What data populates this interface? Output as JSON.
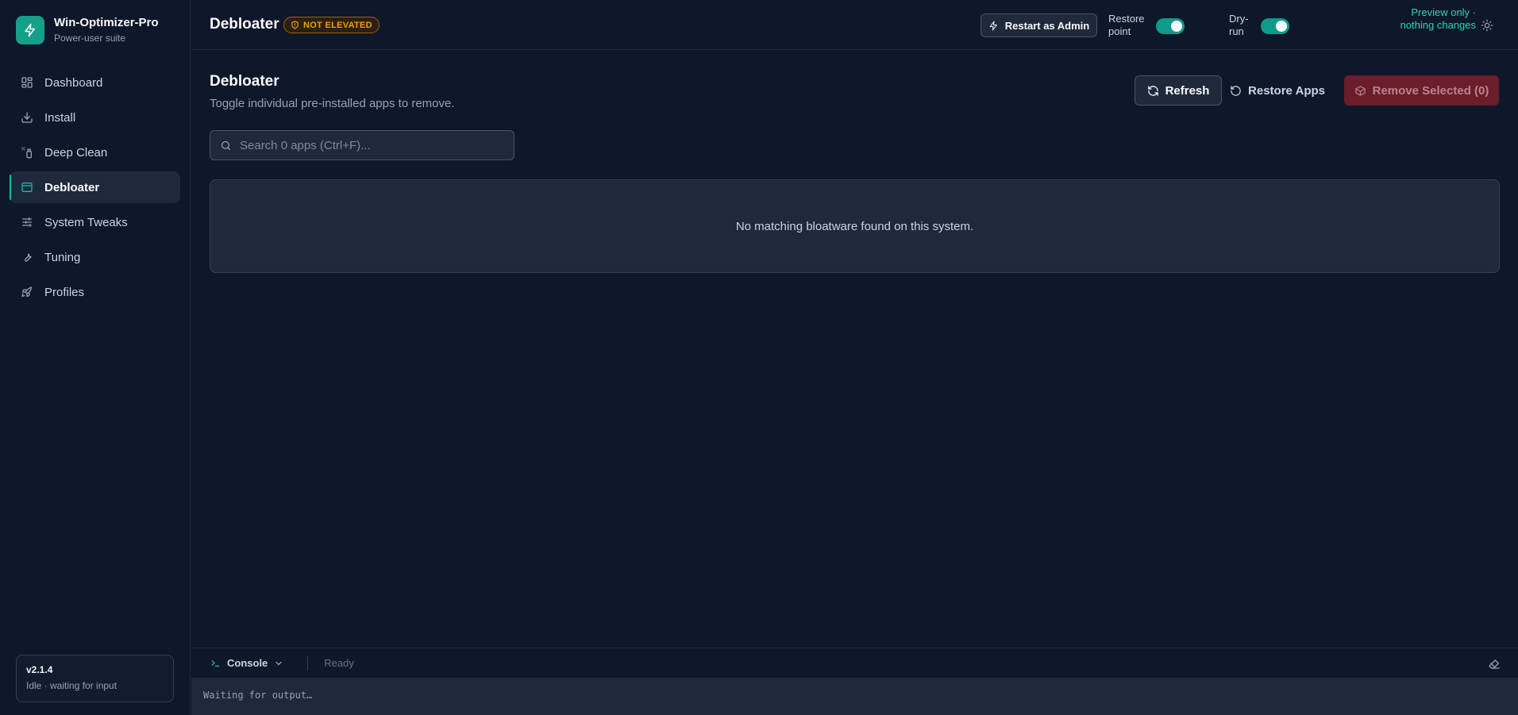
{
  "app": {
    "name": "Win-Optimizer-Pro",
    "subtitle": "Power-user suite",
    "logo_icon": "bolt-icon",
    "accent": "#14a08a"
  },
  "sidebar": {
    "items": [
      {
        "label": "Dashboard",
        "icon": "dashboard-icon",
        "active": false
      },
      {
        "label": "Install",
        "icon": "download-icon",
        "active": false
      },
      {
        "label": "Deep Clean",
        "icon": "spray-icon",
        "active": false
      },
      {
        "label": "Debloater",
        "icon": "window-icon",
        "active": true
      },
      {
        "label": "System Tweaks",
        "icon": "sliders-icon",
        "active": false
      },
      {
        "label": "Tuning",
        "icon": "wrench-icon",
        "active": false
      },
      {
        "label": "Profiles",
        "icon": "rocket-icon",
        "active": false
      }
    ],
    "version": "v2.1.4",
    "status": "Idle · waiting for input"
  },
  "header": {
    "title": "Debloater",
    "badge": "NOT ELEVATED",
    "badge_color": "#f59e0b",
    "restart_label": "Restart as Admin",
    "restore_point_label": "Restore point",
    "restore_point_on": true,
    "dry_run_label": "Dry-run",
    "dry_run_on": true,
    "preview_note": "Preview only · nothing changes",
    "theme_icon": "sun-icon"
  },
  "main": {
    "title": "Debloater",
    "description": "Toggle individual pre-installed apps to remove.",
    "refresh_label": "Refresh",
    "restore_apps_label": "Restore Apps",
    "remove_label": "Remove Selected (0)",
    "search_placeholder": "Search 0 apps (Ctrl+F)...",
    "search_value": "",
    "empty_message": "No matching bloatware found on this system."
  },
  "console": {
    "tab_label": "Console",
    "status": "Ready",
    "output": "Waiting for output…"
  }
}
